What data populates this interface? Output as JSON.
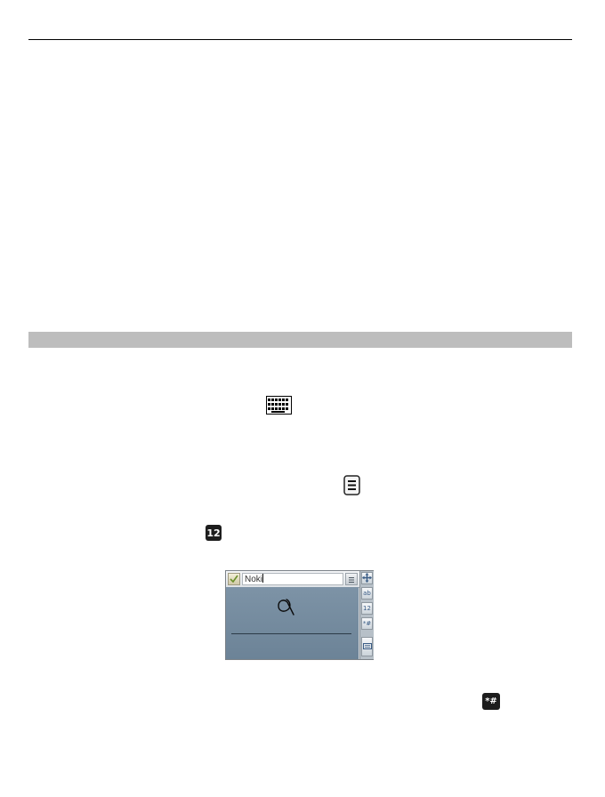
{
  "icons": {
    "keyboard": "keyboard-icon",
    "options": "options-menu-icon",
    "numeric": "numeric-mode-icon",
    "symbols": "special-characters-icon"
  },
  "inline_icon_labels": {
    "numeric": "12",
    "symbols": "*#"
  },
  "handwriting_panel": {
    "input_value": "Noki",
    "side_buttons": [
      "ab",
      "12",
      "*#"
    ]
  },
  "colors": {
    "section_bar": "#bdbdbd",
    "canvas": "#7489a0"
  }
}
